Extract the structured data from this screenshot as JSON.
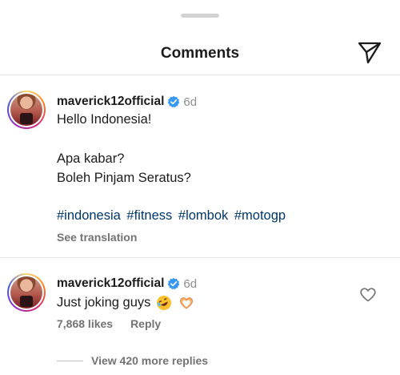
{
  "header": {
    "title": "Comments",
    "share_icon": "paper-plane-icon"
  },
  "comments": [
    {
      "username": "maverick12official",
      "verified": true,
      "time": "6d",
      "lines": [
        "Hello Indonesia!",
        "Apa kabar?",
        "Boleh Pinjam Seratus?"
      ],
      "hashtags": [
        "#indonesia",
        "#fitness",
        "#lombok",
        "#motogp"
      ],
      "see_translation": "See translation"
    },
    {
      "username": "maverick12official",
      "verified": true,
      "time": "6d",
      "text": "Just joking guys",
      "emojis": [
        "rolling-on-floor-laughing-emoji",
        "heart-hands-emoji"
      ],
      "likes": "7,868 likes",
      "reply_label": "Reply",
      "view_replies": "View 420 more replies"
    }
  ],
  "colors": {
    "verified": "#3897f0",
    "hashtag": "#00376b",
    "muted": "#737373"
  }
}
